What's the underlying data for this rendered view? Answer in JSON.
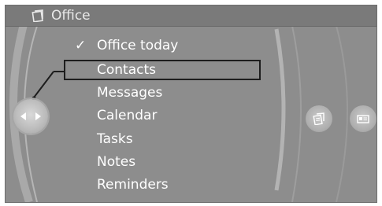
{
  "header": {
    "title": "Office",
    "icon": "office-icon"
  },
  "menu": {
    "items": [
      {
        "label": "Office today",
        "checked": true,
        "selected": false
      },
      {
        "label": "Contacts",
        "checked": false,
        "selected": true
      },
      {
        "label": "Messages",
        "checked": false,
        "selected": false
      },
      {
        "label": "Calendar",
        "checked": false,
        "selected": false
      },
      {
        "label": "Tasks",
        "checked": false,
        "selected": false
      },
      {
        "label": "Notes",
        "checked": false,
        "selected": false
      },
      {
        "label": "Reminders",
        "checked": false,
        "selected": false
      }
    ],
    "check_glyph": "✓"
  },
  "controller": {
    "icon": "controller-arrows-icon"
  },
  "side_buttons": [
    {
      "icon": "documents-icon"
    },
    {
      "icon": "card-icon"
    }
  ],
  "colors": {
    "background": "#8d8d8d",
    "text": "#ffffff",
    "selection_border": "#1d1d1d"
  }
}
